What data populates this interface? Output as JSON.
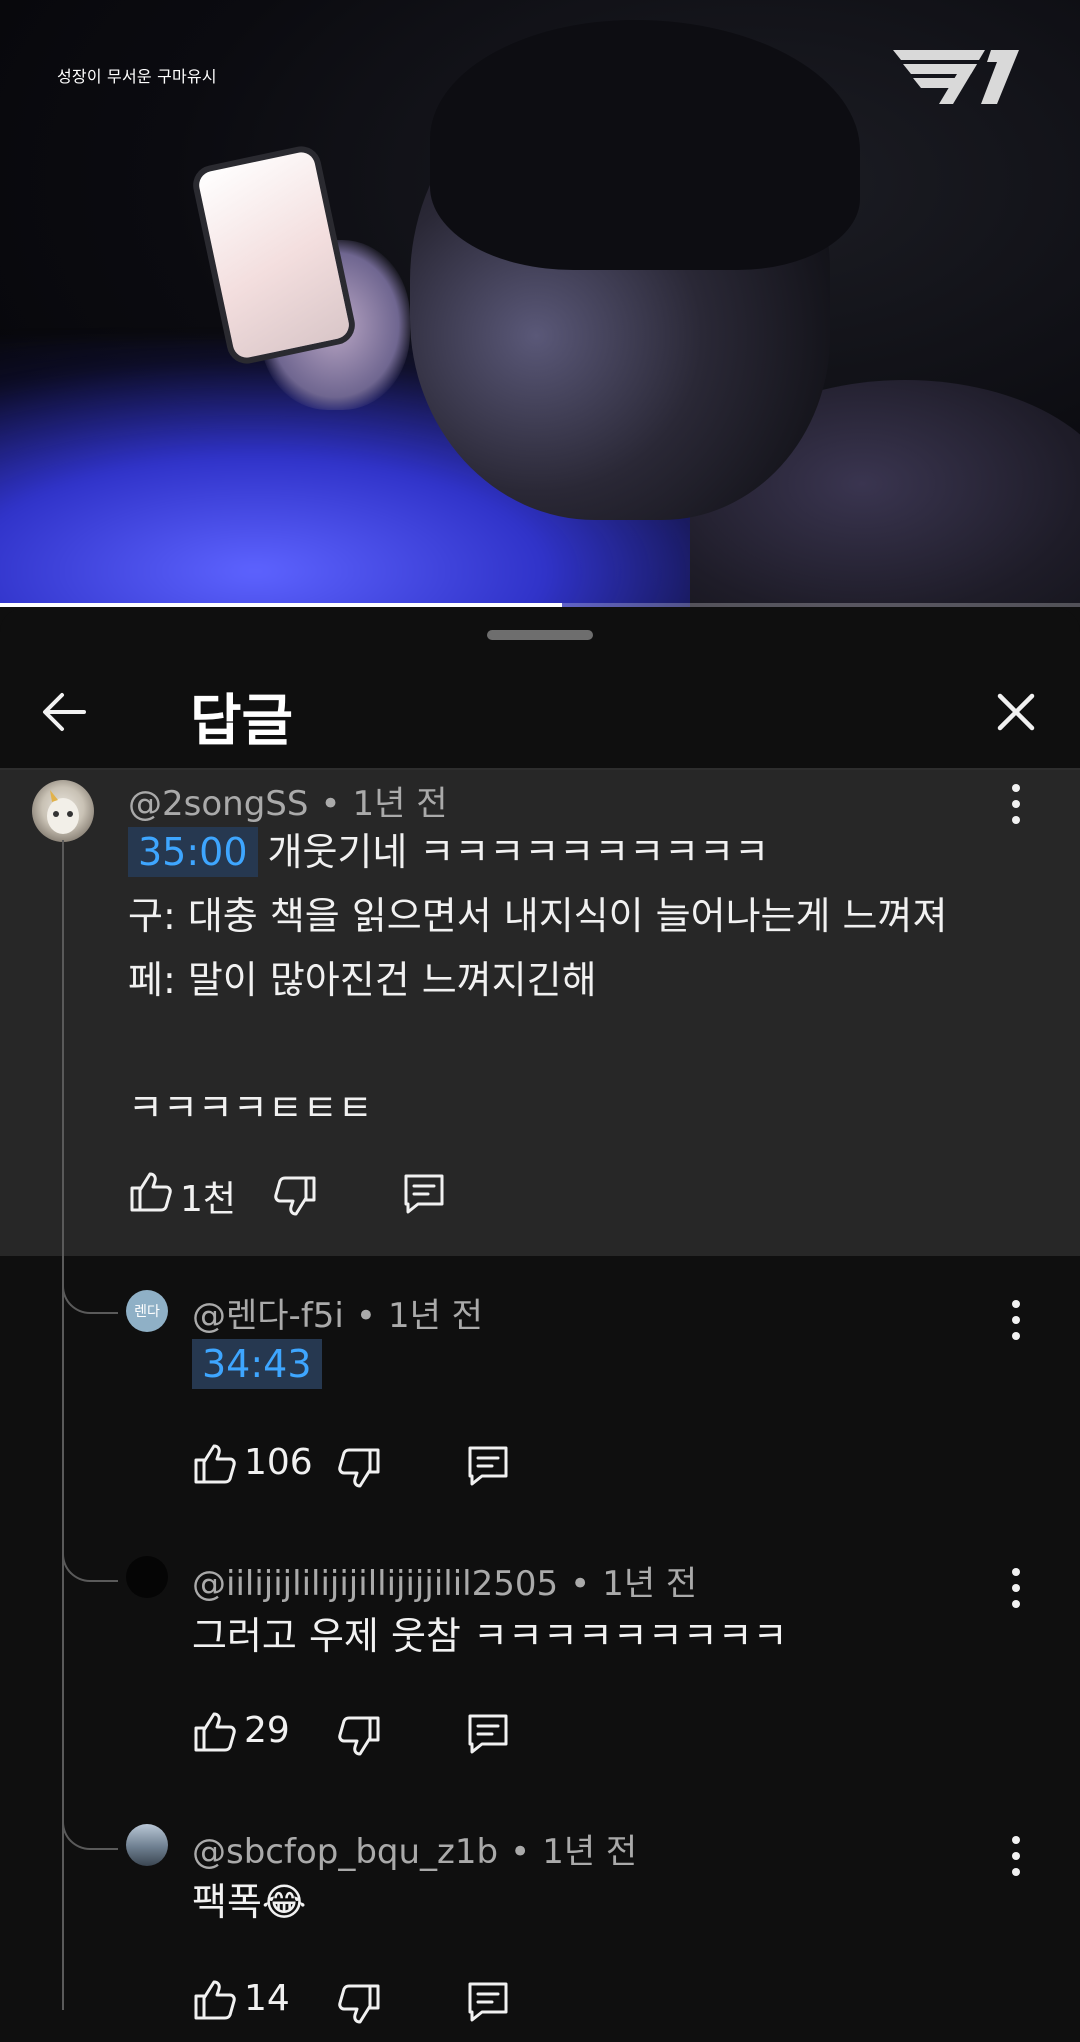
{
  "video": {
    "caption": "성장이 무서운 구마유시",
    "logo": "T1",
    "progress_fraction": 0.52
  },
  "sheet": {
    "title": "답글",
    "back_icon": "arrow-left-icon",
    "close_icon": "close-icon"
  },
  "main_comment": {
    "author": "@2songSS",
    "time": "1년 전",
    "timestamp": "35:00",
    "line1_text": "개웃기네 ㅋㅋㅋㅋㅋㅋㅋㅋㅋㅋ",
    "line2": "구: 대충 책을 읽으면서 내지식이 늘어나는게 느껴져",
    "line3": "페: 말이 많아진건 느껴지긴해",
    "line5": "ㅋㅋㅋㅋㅌㅌㅌ",
    "likes": "1천"
  },
  "replies": [
    {
      "author": "@렌다-f5i",
      "avatar_text": "렌다",
      "time": "1년 전",
      "timestamp": "34:43",
      "text": "",
      "likes": "106"
    },
    {
      "author": "@iilijijlilijijillijijjilil2505",
      "time": "1년 전",
      "text": "그러고 우제 웃참 ㅋㅋㅋㅋㅋㅋㅋㅋㅋ",
      "likes": "29"
    },
    {
      "author": "@sbcfop_bqu_z1b",
      "time": "1년 전",
      "text": "팩폭😂",
      "likes": "14"
    }
  ],
  "colors": {
    "background": "#0f0f0f",
    "highlight": "#272727",
    "timestamp_link": "#3ea6ff",
    "timestamp_bg": "#263850",
    "meta_text": "#aaaaaa"
  }
}
